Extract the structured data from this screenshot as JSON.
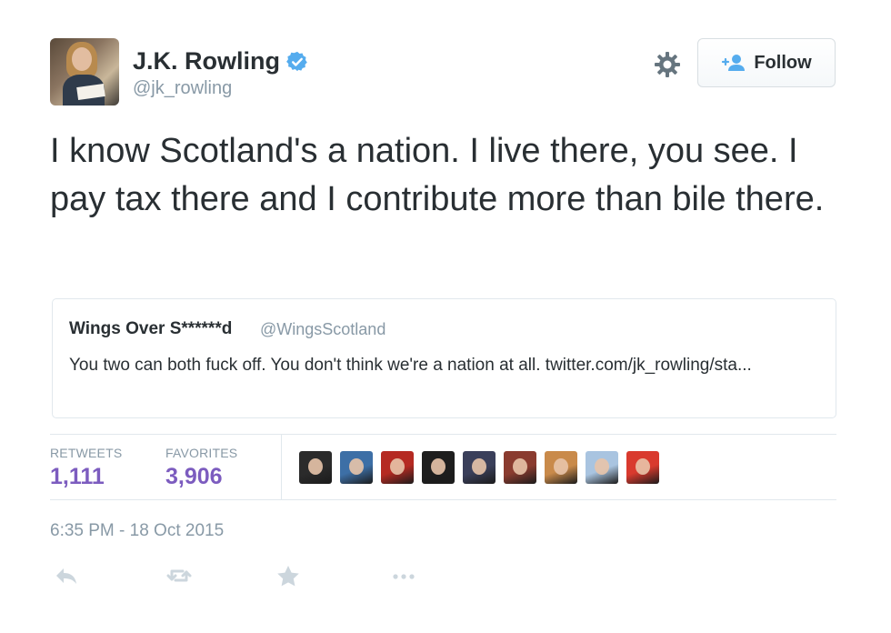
{
  "author": {
    "name": "J.K. Rowling",
    "handle": "@jk_rowling",
    "verified": true,
    "avatar_icon": "profile-photo"
  },
  "header": {
    "settings_icon": "gear-icon",
    "follow_label": "Follow",
    "follow_icon": "add-user-icon"
  },
  "tweet": {
    "text": "I know Scotland's a nation. I live there, you see. I pay tax there and I contribute more than bile there."
  },
  "quoted_tweet": {
    "name": "Wings Over S******d",
    "handle": "@WingsScotland",
    "text": "You two can both fuck off. You don't think we're a nation at all. twitter.com/jk_rowling/sta..."
  },
  "stats": {
    "retweets_label": "RETWEETS",
    "retweets_count": "1,111",
    "favorites_label": "FAVORITES",
    "favorites_count": "3,906"
  },
  "favoriters": [
    {
      "color": "#2b2b2b"
    },
    {
      "color": "#3d6fa6"
    },
    {
      "color": "#b52a22"
    },
    {
      "color": "#1e1e1e"
    },
    {
      "color": "#3a3f5a"
    },
    {
      "color": "#8a3b2f"
    },
    {
      "color": "#c98a4a"
    },
    {
      "color": "#a9c4e0"
    },
    {
      "color": "#d93a2e"
    }
  ],
  "timestamp": "6:35 PM - 18 Oct 2015",
  "actions": [
    "reply-icon",
    "retweet-icon",
    "favorite-icon",
    "more-icon"
  ],
  "colors": {
    "text": "#292f33",
    "muted": "#8899a6",
    "stat_value": "#7c5cbf",
    "verified": "#55acee",
    "follow_icon": "#55acee",
    "action_icon": "#ccd6dd",
    "border": "#e1e8ed"
  }
}
